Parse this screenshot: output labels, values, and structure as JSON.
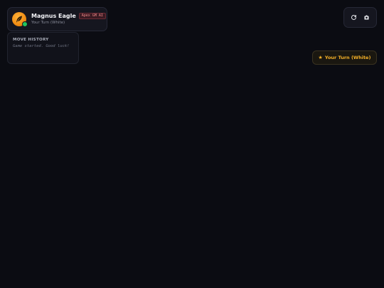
{
  "player": {
    "name": "Magnus Eagle",
    "engine_badge": "Apex GM AI",
    "subtitle": "Your Turn (White)",
    "avatar_icon": "eagle-feather-icon",
    "status": "online",
    "accent_color": "#f08c12"
  },
  "history": {
    "title": "MOVE HISTORY",
    "entries": [
      "Game started. Good luck!"
    ]
  },
  "toolbar": {
    "buttons": [
      {
        "icon": "refresh-icon",
        "label": ""
      },
      {
        "icon": "camera-icon",
        "label": ""
      }
    ]
  },
  "turn_indicator": {
    "icon": "★",
    "text": "Your Turn (White)",
    "color": "#f5b027"
  }
}
